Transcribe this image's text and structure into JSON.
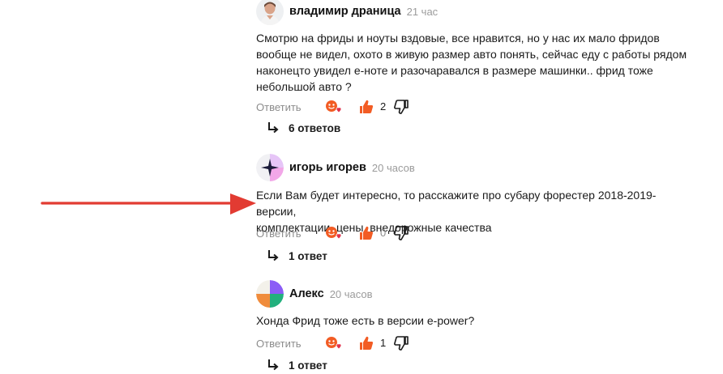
{
  "comments": [
    {
      "author": "владимир драница",
      "time": "21 час",
      "lines": [
        "Смотрю на фриды и ноуты вздовые, все нравится, но у нас их мало фридов",
        "вообще не видел, охото в живую размер авто понять, сейчас еду с работы рядом",
        "наконецто увидел е-ноте и разочаравался в размере машинки.. фрид тоже",
        "небольшой авто ?"
      ],
      "reply_label": "Ответить",
      "likes": "2",
      "likes_color": "#f25c24",
      "replies_label": "6 ответов"
    },
    {
      "author": "игорь игорев",
      "time": "20 часов",
      "lines": [
        "Если Вам будет интересно, то расскажите про субару форестер 2018-2019- версии,",
        "комплектации, цены, внедорожные качества"
      ],
      "reply_label": "Ответить",
      "likes": "0",
      "likes_color": "#8c8c8c",
      "replies_label": "1 ответ"
    },
    {
      "author": "Алекс",
      "time": "20 часов",
      "lines": [
        "Хонда Фрид тоже есть в версии e-power?"
      ],
      "reply_label": "Ответить",
      "likes": "1",
      "likes_color": "#f25c24",
      "replies_label": "1 ответ"
    }
  ],
  "colors": {
    "accent_like": "#f25c24",
    "arrow": "#e23b32",
    "muted": "#8c8c8c"
  },
  "icons": [
    "reaction-icon",
    "like-icon",
    "dislike-icon",
    "reply-arrow-icon"
  ]
}
